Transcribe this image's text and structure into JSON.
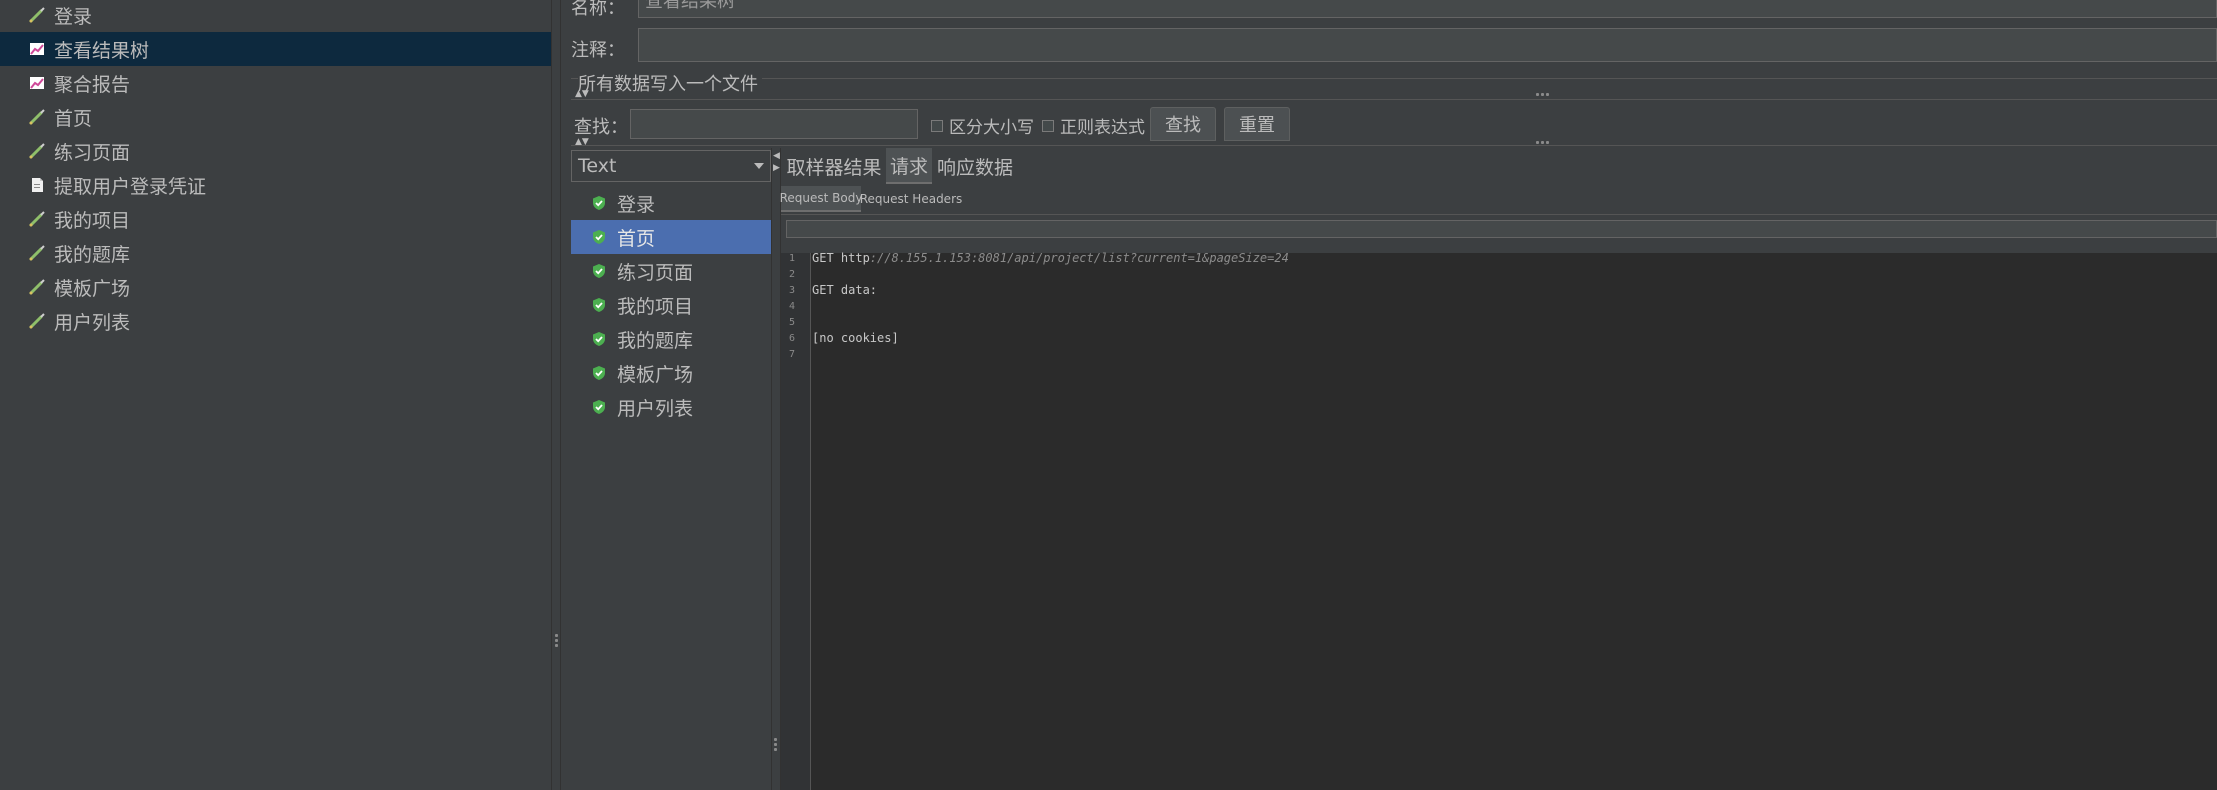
{
  "left_tree": {
    "items": [
      {
        "label": "登录",
        "icon": "sampler-pencil-icon",
        "selected": false
      },
      {
        "label": "查看结果树",
        "icon": "listener-chart-icon",
        "selected": true
      },
      {
        "label": "聚合报告",
        "icon": "listener-chart-icon",
        "selected": false
      },
      {
        "label": "首页",
        "icon": "sampler-pencil-icon",
        "selected": false
      },
      {
        "label": "练习页面",
        "icon": "sampler-pencil-icon",
        "selected": false
      },
      {
        "label": "提取用户登录凭证",
        "icon": "document-icon",
        "selected": false
      },
      {
        "label": "我的项目",
        "icon": "sampler-pencil-icon",
        "selected": false
      },
      {
        "label": "我的题库",
        "icon": "sampler-pencil-icon",
        "selected": false
      },
      {
        "label": "模板广场",
        "icon": "sampler-pencil-icon",
        "selected": false
      },
      {
        "label": "用户列表",
        "icon": "sampler-pencil-icon",
        "selected": false
      }
    ]
  },
  "form": {
    "name_label": "名称：",
    "name_value": "查看结果树",
    "comment_label": "注释：",
    "comment_value": "",
    "file_section_label": "所有数据写入一个文件"
  },
  "search": {
    "label": "查找：",
    "value": "",
    "case_sensitive_label": "区分大小写",
    "regex_label": "正则表达式",
    "find_button": "查找",
    "reset_button": "重置"
  },
  "results": {
    "renderer_select": "Text",
    "items": [
      {
        "label": "登录",
        "status": "success",
        "selected": false
      },
      {
        "label": "首页",
        "status": "success",
        "selected": true
      },
      {
        "label": "练习页面",
        "status": "success",
        "selected": false
      },
      {
        "label": "我的项目",
        "status": "success",
        "selected": false
      },
      {
        "label": "我的题库",
        "status": "success",
        "selected": false
      },
      {
        "label": "模板广场",
        "status": "success",
        "selected": false
      },
      {
        "label": "用户列表",
        "status": "success",
        "selected": false
      }
    ]
  },
  "detail": {
    "tabs": [
      {
        "label": "取样器结果",
        "active": false
      },
      {
        "label": "请求",
        "active": true
      },
      {
        "label": "响应数据",
        "active": false
      }
    ],
    "subtabs": [
      {
        "label": "Request Body",
        "active": true
      },
      {
        "label": "Request Headers",
        "active": false
      }
    ],
    "lines": [
      {
        "num": "1",
        "prefix": "GET http",
        "url": "://8.155.1.153:8081/api/project/list?current=1&pageSize=24"
      },
      {
        "num": "2",
        "prefix": "",
        "url": ""
      },
      {
        "num": "3",
        "prefix": "GET data:",
        "url": ""
      },
      {
        "num": "4",
        "prefix": "",
        "url": ""
      },
      {
        "num": "5",
        "prefix": "",
        "url": ""
      },
      {
        "num": "6",
        "prefix": "[no cookies]",
        "url": ""
      },
      {
        "num": "7",
        "prefix": "",
        "url": ""
      }
    ]
  },
  "colors": {
    "background": "#3c3f41",
    "selected_tree": "#0d293e",
    "selected_result": "#4b6eaf",
    "success_green": "#4caf50",
    "editor_bg": "#2b2b2b"
  }
}
